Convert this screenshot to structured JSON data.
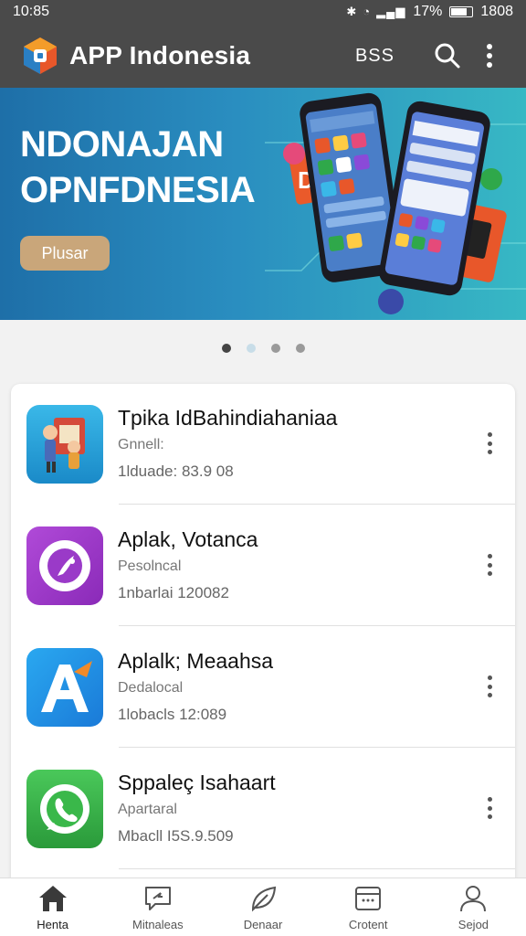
{
  "status": {
    "time": "10:85",
    "battery": "17%",
    "clock_right": "1808"
  },
  "app_bar": {
    "title": "APP Indonesia",
    "action_label": "BSS"
  },
  "banner": {
    "line1": "NDONAJAN",
    "line2": "OPNFDNESIA",
    "button_label": "Plusar"
  },
  "carousel": {
    "count": 4,
    "active": 0
  },
  "apps": [
    {
      "name": "Tpika IdBahindiahaniaa",
      "category": "Gnnell:",
      "downloads": "1lduade: 83.9 08",
      "icon": "toy-figures-icon"
    },
    {
      "name": "Aplak, Votanca",
      "category": "Pesolncal",
      "downloads": "1nbarlai 120082",
      "icon": "purple-chat-icon"
    },
    {
      "name": "Aplalk; Meaahsa",
      "category": "Dedalocal",
      "downloads": "1lobacls 12:089",
      "icon": "letter-a-icon"
    },
    {
      "name": "Sppaleç Isahaart",
      "category": "Apartaral",
      "downloads": "Mbacll I5S.9.509",
      "icon": "green-phone-icon"
    }
  ],
  "bottom_nav": [
    {
      "label": "Henta",
      "icon": "home-icon",
      "active": true
    },
    {
      "label": "Mitnaleas",
      "icon": "chat-bubble-icon",
      "active": false
    },
    {
      "label": "Denaar",
      "icon": "leaf-icon",
      "active": false
    },
    {
      "label": "Crotent",
      "icon": "calendar-icon",
      "active": false
    },
    {
      "label": "Sejod",
      "icon": "person-icon",
      "active": false
    }
  ],
  "colors": {
    "app_bar": "#4a4a4a",
    "banner_start": "#1e6fa8",
    "banner_end": "#37b8c4",
    "accent_button": "#c9a67a"
  }
}
